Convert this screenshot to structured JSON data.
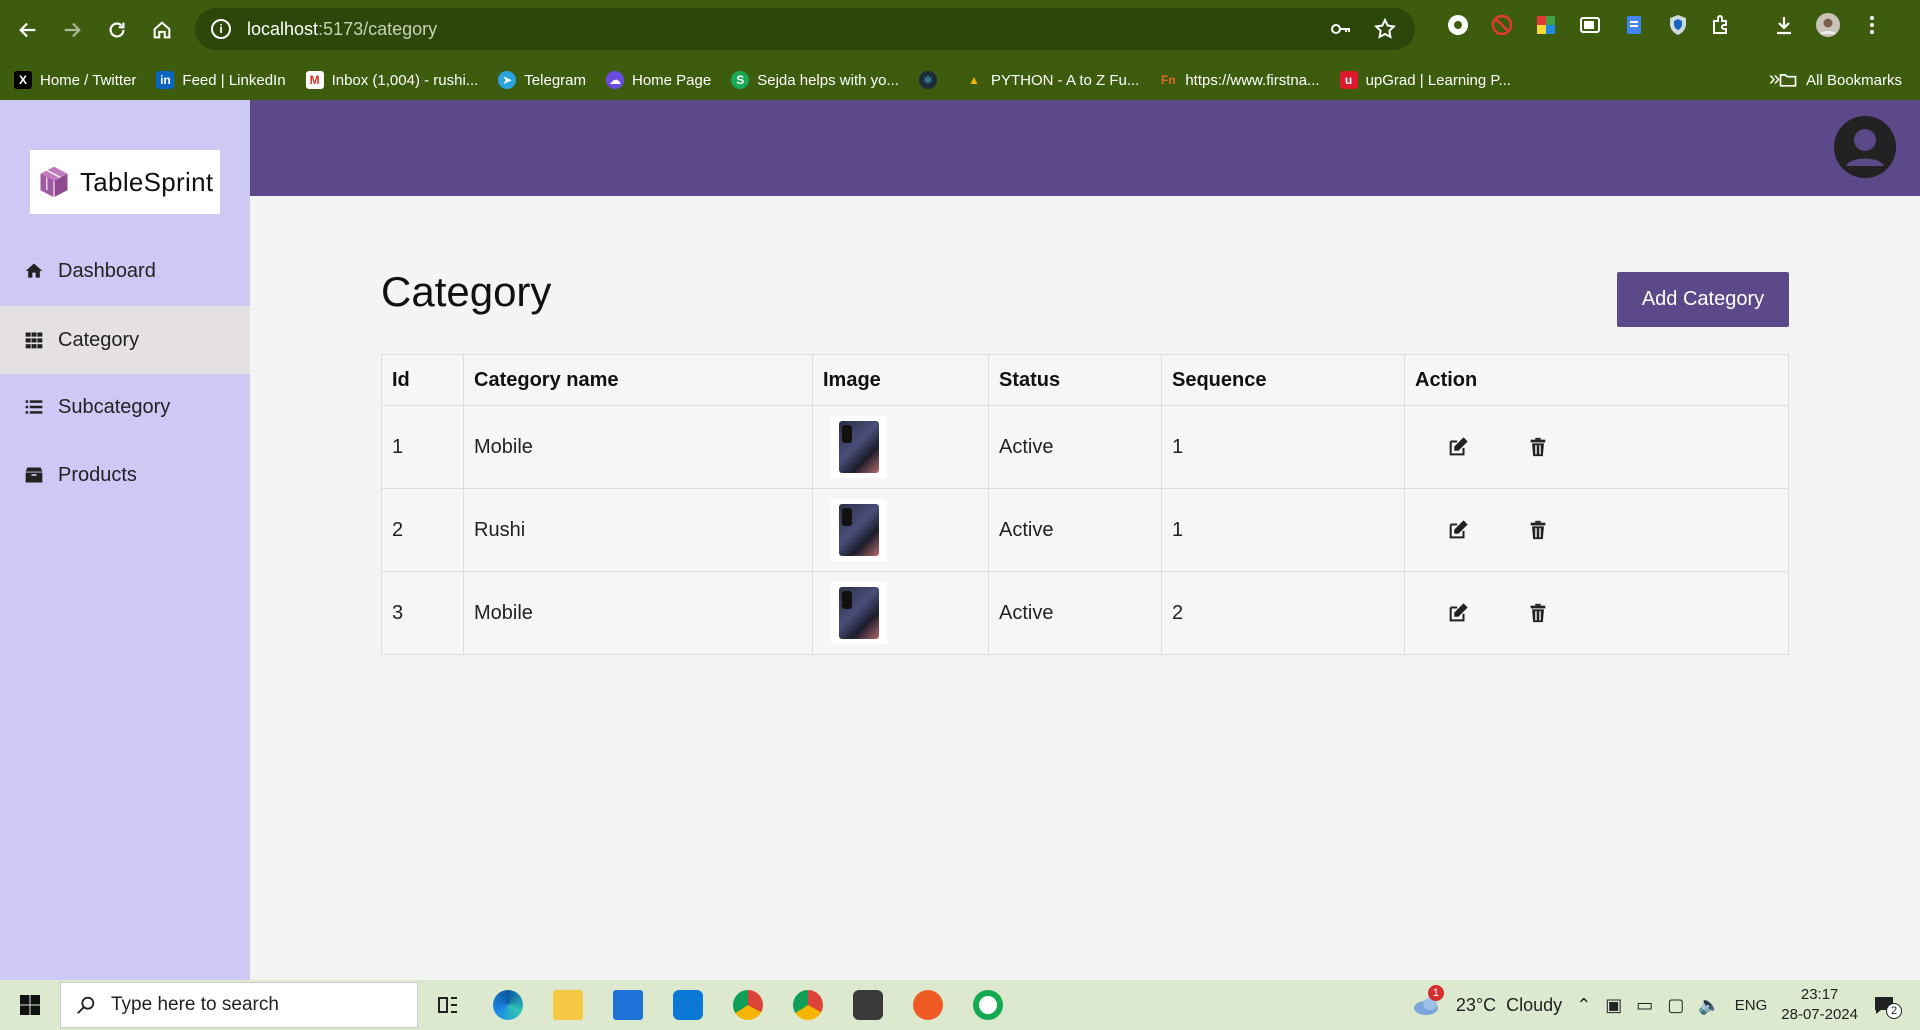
{
  "browser": {
    "url_host": "localhost",
    "url_path": ":5173/category"
  },
  "bookmarks": [
    {
      "label": "Home / Twitter",
      "icon": "x-icon",
      "color": "#000000"
    },
    {
      "label": "Feed | LinkedIn",
      "icon": "linkedin-icon",
      "color": "#0a66c2"
    },
    {
      "label": "Inbox (1,004) - rushi...",
      "icon": "gmail-icon",
      "color": "#d93025"
    },
    {
      "label": "Telegram",
      "icon": "telegram-icon",
      "color": "#2aa3df"
    },
    {
      "label": "Home Page",
      "icon": "cloud-icon",
      "color": "#6a4ce0"
    },
    {
      "label": "Sejda helps with yo...",
      "icon": "sejda-icon",
      "color": "#1aaa55"
    },
    {
      "label": "",
      "icon": "react-icon",
      "color": "#1c2a3a"
    },
    {
      "label": "PYTHON - A to Z Fu...",
      "icon": "drive-icon",
      "color": "#f4b400"
    },
    {
      "label": "https://www.firstna...",
      "icon": "fn-icon",
      "color": "#e06a2b"
    },
    {
      "label": "upGrad | Learning P...",
      "icon": "upgrad-icon",
      "color": "#e0182d"
    }
  ],
  "bookmarks_more": "»",
  "all_bookmarks": "All Bookmarks",
  "brand": {
    "name": "TableSprint"
  },
  "sidebar": {
    "items": [
      {
        "label": "Dashboard",
        "icon": "home-icon"
      },
      {
        "label": "Category",
        "icon": "grid-icon",
        "active": true
      },
      {
        "label": "Subcategory",
        "icon": "list-icon"
      },
      {
        "label": "Products",
        "icon": "box-icon"
      }
    ]
  },
  "main": {
    "title": "Category",
    "add_button": "Add Category",
    "table": {
      "headers": [
        "Id",
        "Category name",
        "Image",
        "Status",
        "Sequence",
        "Action"
      ],
      "rows": [
        {
          "id": "1",
          "name": "Mobile",
          "status": "Active",
          "sequence": "1"
        },
        {
          "id": "2",
          "name": "Rushi",
          "status": "Active",
          "sequence": "1"
        },
        {
          "id": "3",
          "name": "Mobile",
          "status": "Active",
          "sequence": "2"
        }
      ]
    }
  },
  "taskbar": {
    "search_placeholder": "Type here to search",
    "weather": "23°C  Cloudy",
    "weather_badge": "1",
    "lang": "ENG",
    "time": "23:17",
    "date": "28-07-2024",
    "notifications": "2"
  },
  "colors": {
    "accent": "#5c4989",
    "sidebar": "#cdc8f4",
    "browser": "#3d5c0e",
    "status_active": "#1f7a2c"
  }
}
